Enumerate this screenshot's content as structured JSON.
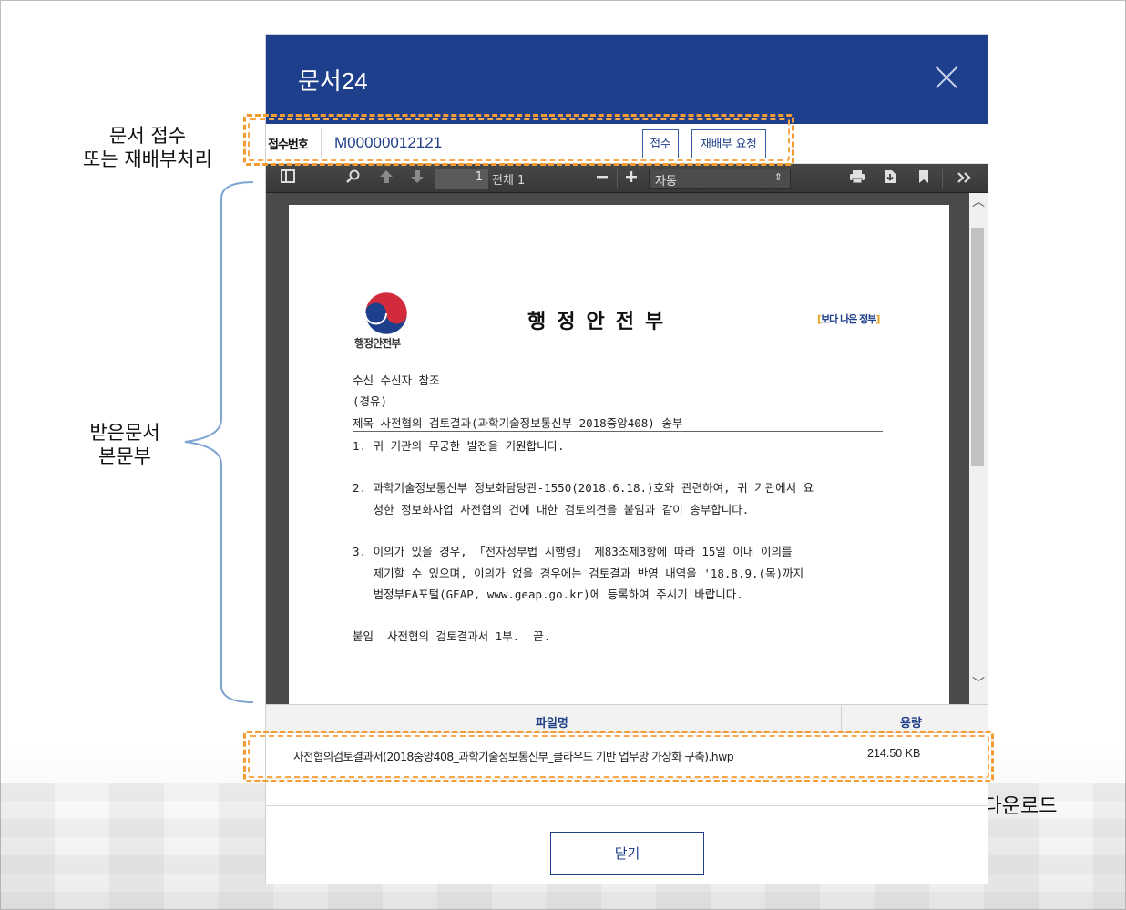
{
  "annotations": {
    "receive_line1": "문서 접수",
    "receive_line2": "또는 재배부처리",
    "body_line1": "받은문서",
    "body_line2": "본문부",
    "download": "클릭하여 첨부파일 다운로드"
  },
  "dialog": {
    "title": "문서24",
    "close_icon": "close-icon"
  },
  "receipt": {
    "label": "접수번호",
    "number": "M00000012121",
    "receive_button": "접수",
    "reassign_button": "재배부 요청"
  },
  "pdf_toolbar": {
    "page_current": "1",
    "page_total": "전체 1",
    "zoom": "자동",
    "icons": [
      "sidebar-toggle-icon",
      "search-icon",
      "previous-page-icon",
      "next-page-icon",
      "zoom-out-icon",
      "zoom-in-icon",
      "print-icon",
      "download-icon",
      "bookmark-icon",
      "more-tools-icon"
    ]
  },
  "document": {
    "emblem_label": "행정안전부",
    "ministry_title": "행정안전부",
    "slogan": "보다 나은 정부",
    "lines": {
      "recipient": "수신  수신자 참조",
      "via": "(경유)",
      "subject": "제목  사전협의 검토결과(과학기술정보통신부 2018중앙408) 송부",
      "p1": "1. 귀 기관의 무궁한 발전을 기원합니다.",
      "p2a": "2. 과학기술정보통신부 정보화담당관-1550(2018.6.18.)호와 관련하여, 귀 기관에서 요",
      "p2b": "   청한 정보화사업 사전협의 건에 대한 검토의견을 붙임과 같이 송부합니다.",
      "p3a": "3. 이의가 있을 경우, 「전자정부법 시행령」 제83조제3항에 따라 15일 이내 이의를",
      "p3b": "   제기할 수 있으며, 이의가 없을 경우에는 검토결과 반영 내역을 '18.8.9.(목)까지",
      "p3c": "   범정부EA포털(GEAP, www.geap.go.kr)에 등록하여 주시기 바랍니다.",
      "attach": "붙임  사전협의 검토결과서 1부.  끝."
    }
  },
  "attachments": {
    "col_name": "파일명",
    "col_size": "용량",
    "rows": [
      {
        "name": "사전협의검토결과서(2018중앙408_과학기술정보통신부_클라우드 기반 업무망 가상화 구축).hwp",
        "size": "214.50 KB"
      }
    ]
  },
  "footer": {
    "close_button": "닫기"
  },
  "colors": {
    "header": "#1e3f8c",
    "accent": "#1f3f86",
    "highlight": "#f39c32",
    "brace": "#7fa3d1"
  }
}
